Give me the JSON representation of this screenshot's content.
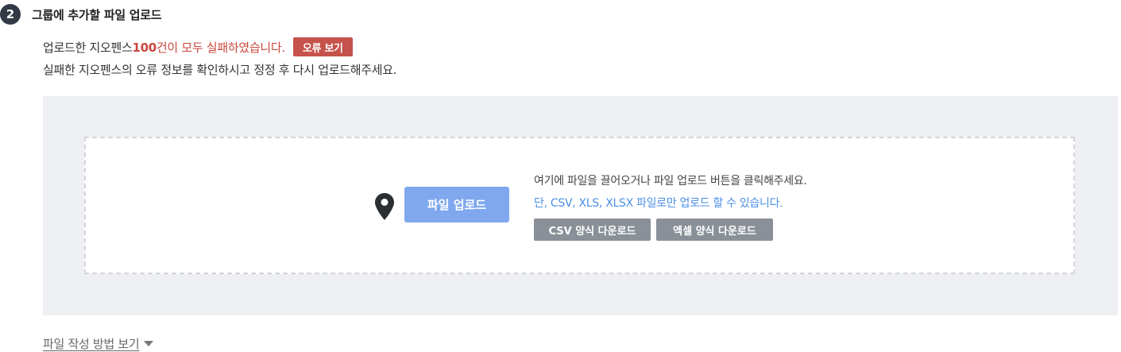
{
  "step": {
    "number": "2",
    "title": "그룹에 추가할 파일 업로드"
  },
  "message": {
    "line1_prefix": "업로드한 지오펜스 ",
    "fail_count": "100",
    "line1_suffix": "건이 모두 실패하였습니다.",
    "error_button": "오류 보기",
    "line2": "실패한 지오펜스의 오류 정보를 확인하시고 정정 후 다시 업로드해주세요."
  },
  "upload": {
    "button_label": "파일 업로드",
    "guide_text": "여기에 파일을 끌어오거나 파일 업로드 버튼을 클릭해주세요.",
    "format_text": "단, CSV, XLS, XLSX 파일로만 업로드 할 수 있습니다.",
    "csv_template_label": "CSV 양식 다운로드",
    "excel_template_label": "엑셀 양식 다운로드"
  },
  "howto": {
    "label": "파일 작성 방법 보기",
    "icon": "caret-down-icon"
  },
  "colors": {
    "error": "#c9473d",
    "error_button": "#c5524b",
    "primary_button": "#7fa8ee",
    "info_text": "#4a8ee6",
    "template_button": "#8a9097",
    "area_background": "#eeeff2"
  }
}
